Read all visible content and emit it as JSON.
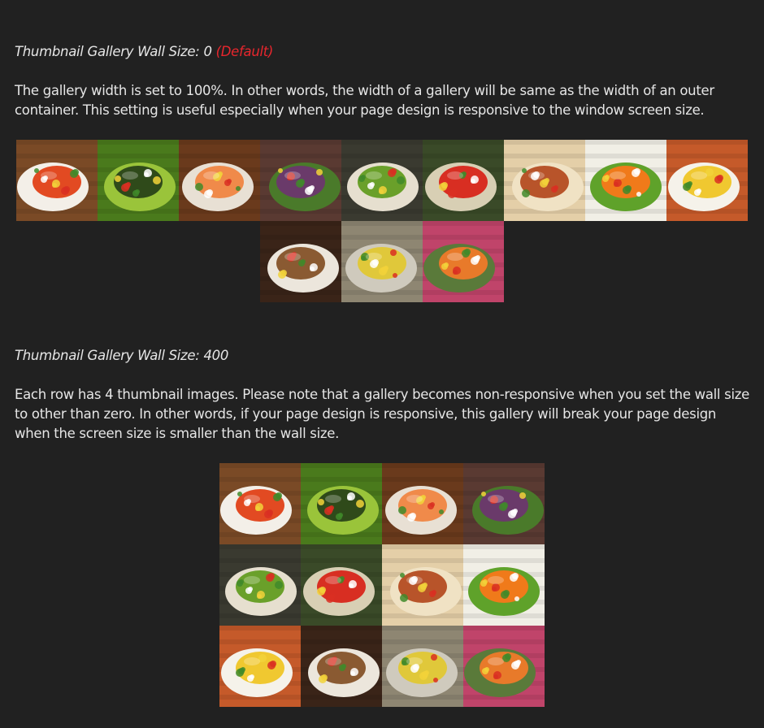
{
  "sections": [
    {
      "title": "Thumbnail Gallery Wall Size: 0",
      "title_suffix": "(Default)",
      "description": "The gallery width is set to 100%.  In other words, the width of a gallery will be same as the width of an outer container. This setting is useful especially when your page design is responsive to the window screen size."
    },
    {
      "title": "Thumbnail Gallery Wall Size: 400",
      "title_suffix": "",
      "description": "Each row has 4 thumbnail images. Please note that a gallery becomes non-responsive when you set the wall size to other than zero. In other words, if your page design is responsive, this gallery will break your page design when the screen size is smaller than the wall size."
    }
  ],
  "thumbnails": [
    {
      "name": "kimchi-plate-thumb",
      "bg": "#7a4a26",
      "accent": "#e24a22",
      "plate": "#f3efe8"
    },
    {
      "name": "rice-balls-thumb",
      "bg": "#4a7a1c",
      "accent": "#2f4a1a",
      "plate": "#9ac43a"
    },
    {
      "name": "grilled-salmon-thumb",
      "bg": "#6a3a1c",
      "accent": "#f08a4a",
      "plate": "#e8e0d4"
    },
    {
      "name": "fig-salad-thumb",
      "bg": "#5a3a32",
      "accent": "#6a3a6a",
      "plate": "#4a7a2a"
    },
    {
      "name": "avocado-toast-thumb",
      "bg": "#3a3a30",
      "accent": "#6aa02a",
      "plate": "#e6dfcf"
    },
    {
      "name": "tofu-salad-thumb",
      "bg": "#3a4a28",
      "accent": "#d82e22",
      "plate": "#d8cfb4"
    },
    {
      "name": "pinwheel-pastries-thumb",
      "bg": "#e4cfa8",
      "accent": "#b8542a",
      "plate": "#f0e2c4"
    },
    {
      "name": "shrimp-salad-thumb",
      "bg": "#f1efe6",
      "accent": "#f07a1a",
      "plate": "#5fa22a"
    },
    {
      "name": "noodle-bowl-thumb",
      "bg": "#c55a2a",
      "accent": "#f0c830",
      "plate": "#f5f2ea"
    },
    {
      "name": "stir-fry-noodles-thumb",
      "bg": "#3a2418",
      "accent": "#8a5a32",
      "plate": "#ece6dc"
    },
    {
      "name": "dried-pasta-thumb",
      "bg": "#8e8672",
      "accent": "#e0c83a",
      "plate": "#cfcabd"
    },
    {
      "name": "carrot-pasta-thumb",
      "bg": "#c0446a",
      "accent": "#e87a2a",
      "plate": "#5a7a3a"
    }
  ]
}
